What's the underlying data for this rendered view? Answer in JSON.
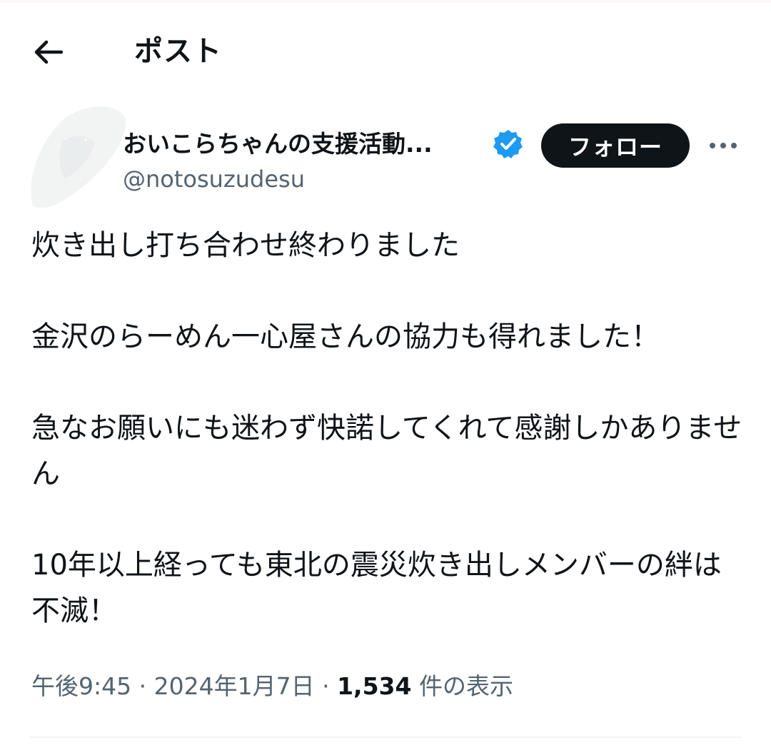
{
  "header": {
    "title": "ポスト",
    "back_icon": "arrow-left-icon"
  },
  "author": {
    "display_name": "おいこらちゃんの支援活動...",
    "handle": "@notosuzudesu",
    "verified_icon": "verified-badge-icon",
    "verified_color": "#1d9bf0",
    "follow_label": "フォロー",
    "more_icon": "more-horizontal-icon"
  },
  "post": {
    "line1": "炊き出し打ち合わせ終わりました",
    "line2": "金沢のらーめん一心屋さんの協力も得れました！",
    "line3": "急なお願いにも迷わず快諾してくれて感謝しかありません",
    "line4": "10年以上経っても東北の震災炊き出しメンバーの絆は不滅！"
  },
  "meta": {
    "time": "午後9:45",
    "separator": "·",
    "date": "2024年1月7日",
    "views_count": "1,534",
    "views_label": "件の表示"
  },
  "colors": {
    "text": "#0f1419",
    "secondary": "#536471",
    "follow_bg": "#0f1419",
    "divider": "#eff3f4"
  }
}
